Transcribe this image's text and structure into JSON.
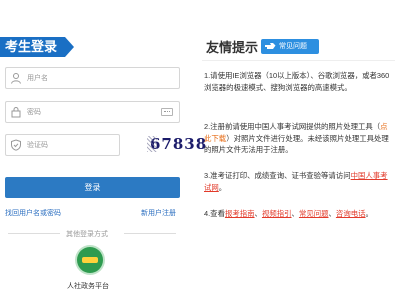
{
  "login": {
    "title": "考生登录",
    "username_placeholder": "用户名",
    "password_placeholder": "密码",
    "captcha_placeholder": "验证码",
    "captcha_text": "67838",
    "login_button": "登录",
    "forgot_link": "找回用户名或密码",
    "register_link": "新用户注册",
    "other_methods": "其他登录方式",
    "gov_platform_label": "人社政务平台"
  },
  "tips": {
    "title": "友情提示",
    "faq_button": "常见问题",
    "items": [
      {
        "num": "1.",
        "text": "请使用IE浏览器（10以上版本）、谷歌浏览器，或者360浏览器的极速模式、搜狗浏览器的高速模式。"
      },
      {
        "num": "2.",
        "pre": "注册前请使用中国人事考试网提供的照片处理工具（",
        "link": "点此下载",
        "post": "）对照片文件进行处理。未经该照片处理工具处理的照片文件无法用于注册。"
      },
      {
        "num": "3.",
        "pre": "准考证打印、成绩查询、证书查验等请访问",
        "link": "中国人事考试网",
        "post": "。"
      },
      {
        "num": "4.",
        "pre": "查看",
        "links": [
          "报考指南",
          "视频指引",
          "常见问题",
          "咨询电话"
        ],
        "sep": "、",
        "post": "。"
      }
    ]
  }
}
